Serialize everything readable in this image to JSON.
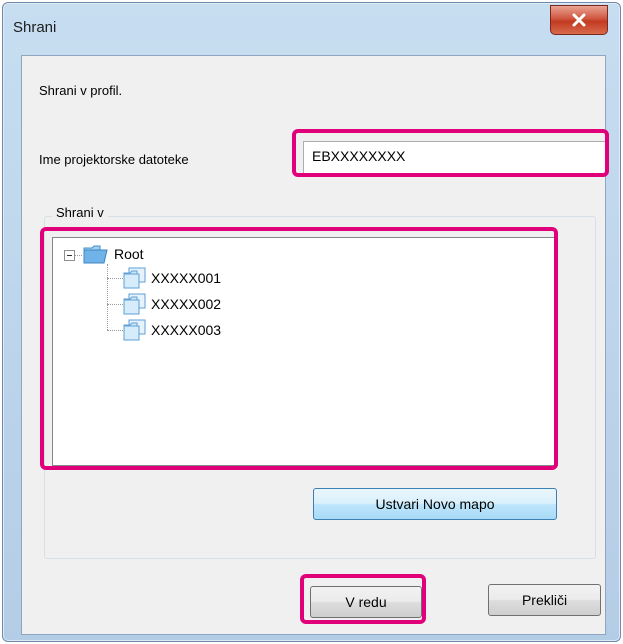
{
  "window": {
    "title": "Shrani"
  },
  "prompt": "Shrani v profil.",
  "filename": {
    "label": "Ime projektorske datoteke",
    "value": "EBXXXXXXXX"
  },
  "save_in": {
    "caption": "Shrani v",
    "tree": {
      "root": "Root",
      "children": [
        "XXXXX001",
        "XXXXX002",
        "XXXXX003"
      ]
    }
  },
  "buttons": {
    "new_folder": "Ustvari Novo mapo",
    "ok": "V redu",
    "cancel": "Prekliči"
  },
  "colors": {
    "highlight": "#e0007a",
    "folder": "#6fb3e8"
  },
  "icons": {
    "close": "close-icon",
    "expander": "minus-icon",
    "folder": "folder-icon"
  }
}
